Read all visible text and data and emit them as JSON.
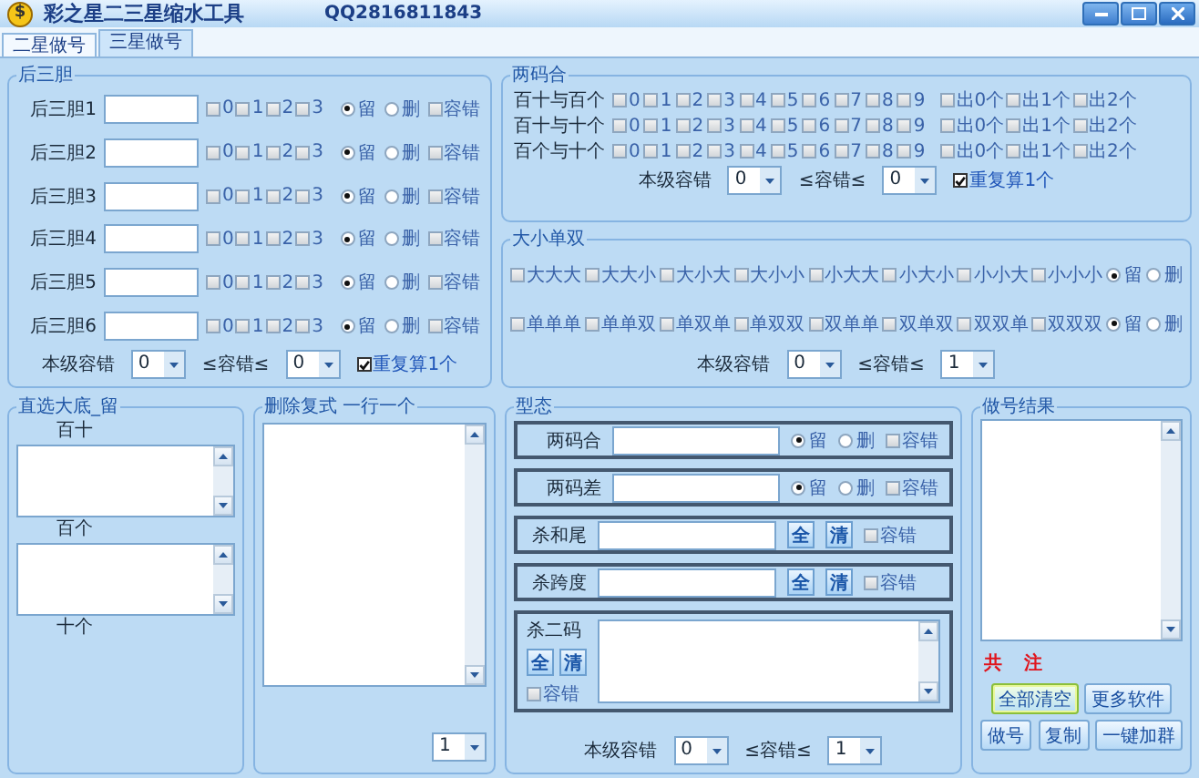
{
  "window": {
    "icon": "$",
    "title": "彩之星二三星缩水工具",
    "qq": "QQ2816811843"
  },
  "tabs": [
    {
      "label": "二星做号",
      "selected": false
    },
    {
      "label": "三星做号",
      "selected": true
    }
  ],
  "hou_san_dan": {
    "title": "后三胆",
    "rows": [
      {
        "label": "后三胆1",
        "digits": [
          {
            "label": "0",
            "checked": false
          },
          {
            "label": "1",
            "checked": false
          },
          {
            "label": "2",
            "checked": false
          },
          {
            "label": "3",
            "checked": false
          }
        ],
        "options": [
          {
            "label": "留",
            "selected": true
          },
          {
            "label": "删",
            "selected": false
          }
        ],
        "tolerance": {
          "label": "容错",
          "checked": false
        }
      },
      {
        "label": "后三胆2",
        "digits": [
          {
            "label": "0",
            "checked": false
          },
          {
            "label": "1",
            "checked": false
          },
          {
            "label": "2",
            "checked": false
          },
          {
            "label": "3",
            "checked": false
          }
        ],
        "options": [
          {
            "label": "留",
            "selected": true
          },
          {
            "label": "删",
            "selected": false
          }
        ],
        "tolerance": {
          "label": "容错",
          "checked": false
        }
      },
      {
        "label": "后三胆3",
        "digits": [
          {
            "label": "0",
            "checked": false
          },
          {
            "label": "1",
            "checked": false
          },
          {
            "label": "2",
            "checked": false
          },
          {
            "label": "3",
            "checked": false
          }
        ],
        "options": [
          {
            "label": "留",
            "selected": true
          },
          {
            "label": "删",
            "selected": false
          }
        ],
        "tolerance": {
          "label": "容错",
          "checked": false
        }
      },
      {
        "label": "后三胆4",
        "digits": [
          {
            "label": "0",
            "checked": false
          },
          {
            "label": "1",
            "checked": false
          },
          {
            "label": "2",
            "checked": false
          },
          {
            "label": "3",
            "checked": false
          }
        ],
        "options": [
          {
            "label": "留",
            "selected": true
          },
          {
            "label": "删",
            "selected": false
          }
        ],
        "tolerance": {
          "label": "容错",
          "checked": false
        }
      },
      {
        "label": "后三胆5",
        "digits": [
          {
            "label": "0",
            "checked": false
          },
          {
            "label": "1",
            "checked": false
          },
          {
            "label": "2",
            "checked": false
          },
          {
            "label": "3",
            "checked": false
          }
        ],
        "options": [
          {
            "label": "留",
            "selected": true
          },
          {
            "label": "删",
            "selected": false
          }
        ],
        "tolerance": {
          "label": "容错",
          "checked": false
        }
      },
      {
        "label": "后三胆6",
        "digits": [
          {
            "label": "0",
            "checked": false
          },
          {
            "label": "1",
            "checked": false
          },
          {
            "label": "2",
            "checked": false
          },
          {
            "label": "3",
            "checked": false
          }
        ],
        "options": [
          {
            "label": "留",
            "selected": true
          },
          {
            "label": "删",
            "selected": false
          }
        ],
        "tolerance": {
          "label": "容错",
          "checked": false
        }
      }
    ],
    "footer": {
      "label": "本级容错",
      "min": "0",
      "relation": "≤容错≤",
      "max": "0",
      "repeat": {
        "label": "重复算1个",
        "checked": true
      }
    }
  },
  "liang_ma_he": {
    "title": "两码合",
    "rows": [
      {
        "label": "百十与百个",
        "digits": [
          {
            "label": "0",
            "checked": false
          },
          {
            "label": "1",
            "checked": false
          },
          {
            "label": "2",
            "checked": false
          },
          {
            "label": "3",
            "checked": false
          },
          {
            "label": "4",
            "checked": false
          },
          {
            "label": "5",
            "checked": false
          },
          {
            "label": "6",
            "checked": false
          },
          {
            "label": "7",
            "checked": false
          },
          {
            "label": "8",
            "checked": false
          },
          {
            "label": "9",
            "checked": false
          }
        ],
        "outs": [
          {
            "label": "出0个",
            "checked": false
          },
          {
            "label": "出1个",
            "checked": false
          },
          {
            "label": "出2个",
            "checked": false
          }
        ]
      },
      {
        "label": "百十与十个",
        "digits": [
          {
            "label": "0",
            "checked": false
          },
          {
            "label": "1",
            "checked": false
          },
          {
            "label": "2",
            "checked": false
          },
          {
            "label": "3",
            "checked": false
          },
          {
            "label": "4",
            "checked": false
          },
          {
            "label": "5",
            "checked": false
          },
          {
            "label": "6",
            "checked": false
          },
          {
            "label": "7",
            "checked": false
          },
          {
            "label": "8",
            "checked": false
          },
          {
            "label": "9",
            "checked": false
          }
        ],
        "outs": [
          {
            "label": "出0个",
            "checked": false
          },
          {
            "label": "出1个",
            "checked": false
          },
          {
            "label": "出2个",
            "checked": false
          }
        ]
      },
      {
        "label": "百个与十个",
        "digits": [
          {
            "label": "0",
            "checked": false
          },
          {
            "label": "1",
            "checked": false
          },
          {
            "label": "2",
            "checked": false
          },
          {
            "label": "3",
            "checked": false
          },
          {
            "label": "4",
            "checked": false
          },
          {
            "label": "5",
            "checked": false
          },
          {
            "label": "6",
            "checked": false
          },
          {
            "label": "7",
            "checked": false
          },
          {
            "label": "8",
            "checked": false
          },
          {
            "label": "9",
            "checked": false
          }
        ],
        "outs": [
          {
            "label": "出0个",
            "checked": false
          },
          {
            "label": "出1个",
            "checked": false
          },
          {
            "label": "出2个",
            "checked": false
          }
        ]
      }
    ],
    "footer": {
      "label": "本级容错",
      "min": "0",
      "relation": "≤容错≤",
      "max": "0",
      "repeat": {
        "label": "重复算1个",
        "checked": true
      }
    }
  },
  "da_xiao_dan_shuang": {
    "title": "大小单双",
    "rows": [
      {
        "items": [
          {
            "label": "大大大",
            "checked": false
          },
          {
            "label": "大大小",
            "checked": false
          },
          {
            "label": "大小大",
            "checked": false
          },
          {
            "label": "大小小",
            "checked": false
          },
          {
            "label": "小大大",
            "checked": false
          },
          {
            "label": "小大小",
            "checked": false
          },
          {
            "label": "小小大",
            "checked": false
          },
          {
            "label": "小小小",
            "checked": false
          }
        ],
        "options": [
          {
            "label": "留",
            "selected": true
          },
          {
            "label": "删",
            "selected": false
          }
        ]
      },
      {
        "items": [
          {
            "label": "单单单",
            "checked": false
          },
          {
            "label": "单单双",
            "checked": false
          },
          {
            "label": "单双单",
            "checked": false
          },
          {
            "label": "单双双",
            "checked": false
          },
          {
            "label": "双单单",
            "checked": false
          },
          {
            "label": "双单双",
            "checked": false
          },
          {
            "label": "双双单",
            "checked": false
          },
          {
            "label": "双双双",
            "checked": false
          }
        ],
        "options": [
          {
            "label": "留",
            "selected": true
          },
          {
            "label": "删",
            "selected": false
          }
        ]
      }
    ],
    "footer": {
      "label": "本级容错",
      "min": "0",
      "relation": "≤容错≤",
      "max": "1"
    }
  },
  "zhi_xuan": {
    "title": "直选大底_留",
    "lists": [
      {
        "kind": "list",
        "label": "百十"
      },
      {
        "kind": "list",
        "label": "百个"
      },
      {
        "kind": "label",
        "label": "十个"
      }
    ]
  },
  "delete_multi": {
    "title": "删除复式 一行一个",
    "count": "1"
  },
  "xing_tai": {
    "title": "型态",
    "rows": [
      {
        "kind": "radio",
        "label": "两码合",
        "options": [
          {
            "label": "留",
            "selected": true
          },
          {
            "label": "删",
            "selected": false
          }
        ],
        "tolerance": {
          "label": "容错",
          "checked": false
        }
      },
      {
        "kind": "radio",
        "label": "两码差",
        "options": [
          {
            "label": "留",
            "selected": true
          },
          {
            "label": "删",
            "selected": false
          }
        ],
        "tolerance": {
          "label": "容错",
          "checked": false
        }
      },
      {
        "kind": "buttons",
        "label": "杀和尾",
        "buttons": [
          "全",
          "清"
        ],
        "tolerance": {
          "label": "容错",
          "checked": false
        }
      },
      {
        "kind": "buttons",
        "label": "杀跨度",
        "buttons": [
          "全",
          "清"
        ],
        "tolerance": {
          "label": "容错",
          "checked": false
        }
      },
      {
        "kind": "area",
        "label": "杀二码",
        "buttons": [
          "全",
          "清"
        ],
        "tolerance": {
          "label": "容错",
          "checked": false
        }
      }
    ],
    "footer": {
      "label": "本级容错",
      "min": "0",
      "relation": "≤容错≤",
      "max": "1"
    }
  },
  "results": {
    "title": "做号结果",
    "total_prefix": "共",
    "total_suffix": "注",
    "buttons": [
      {
        "label": "全部清空",
        "focused": true
      },
      {
        "label": "更多软件",
        "focused": false
      },
      {
        "label": "做号",
        "focused": false
      },
      {
        "label": "复制",
        "focused": false
      },
      {
        "label": "一键加群",
        "focused": false
      }
    ]
  }
}
